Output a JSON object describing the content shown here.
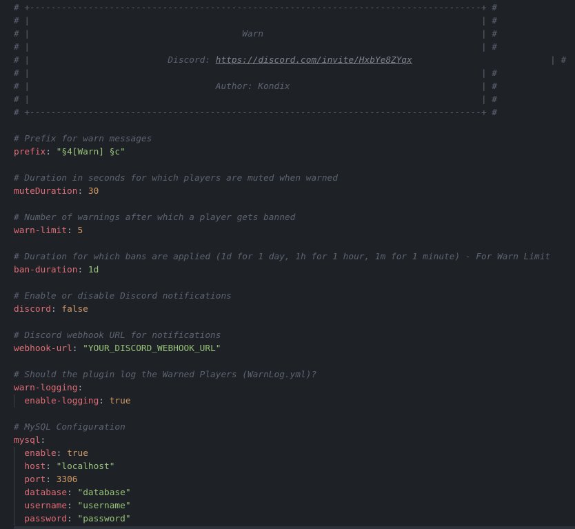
{
  "header_box": {
    "border_top": "# +-------------------------------------------------------------------------------------+ #",
    "spacer_line": "# |                                                                                     | #",
    "title_line": "# |                                        Warn                                         | #",
    "discord_prefix": "# |                          Discord: ",
    "discord_url": "https://discord.com/invite/HxbYe8ZYqx",
    "discord_suffix": "                          | #",
    "author_line": "# |                                   Author: Kondix                                    | #",
    "border_bottom": "# +-------------------------------------------------------------------------------------+ #"
  },
  "config": {
    "prefix": {
      "comment": "# Prefix for warn messages",
      "key": "prefix",
      "value": "\"§4[Warn] §c\""
    },
    "mute_duration": {
      "comment": "# Duration in seconds for which players are muted when warned",
      "key": "muteDuration",
      "value": "30"
    },
    "warn_limit": {
      "comment": "# Number of warnings after which a player gets banned",
      "key": "warn-limit",
      "value": "5"
    },
    "ban_duration": {
      "comment": "# Duration for which bans are applied (1d for 1 day, 1h for 1 hour, 1m for 1 minute) - For Warn Limit",
      "key": "ban-duration",
      "value": "1d"
    },
    "discord": {
      "comment": "# Enable or disable Discord notifications",
      "key": "discord",
      "value": "false"
    },
    "webhook_url": {
      "comment": "# Discord webhook URL for notifications",
      "key": "webhook-url",
      "value": "\"YOUR_DISCORD_WEBHOOK_URL\""
    },
    "warn_logging": {
      "comment": "# Should the plugin log the Warned Players (WarnLog.yml)?",
      "key": "warn-logging",
      "enable_logging_key": "enable-logging",
      "enable_logging_value": "true"
    },
    "mysql": {
      "comment": "# MySQL Configuration",
      "key": "mysql",
      "enable_key": "enable",
      "enable_value": "true",
      "host_key": "host",
      "host_value": "\"localhost\"",
      "port_key": "port",
      "port_value": "3306",
      "database_key": "database",
      "database_value": "\"database\"",
      "username_key": "username",
      "username_value": "\"username\"",
      "password_key": "password",
      "password_value": "\"password\""
    }
  },
  "colors": {
    "background": "#1e2227",
    "comment": "#5c6370",
    "key": "#e06c75",
    "string": "#98c379",
    "number": "#d19a66",
    "punctuation": "#abb2bf"
  }
}
